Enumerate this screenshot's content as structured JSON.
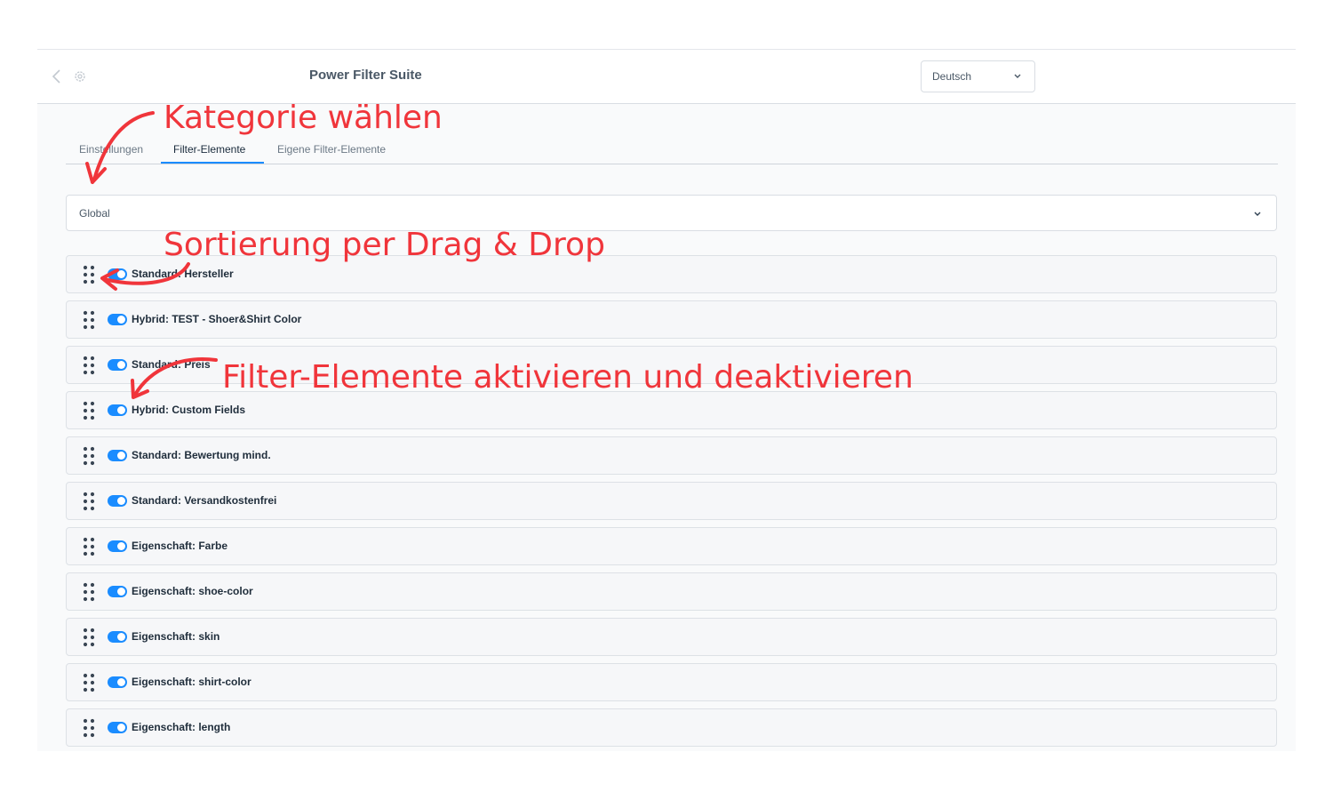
{
  "header": {
    "title": "Power Filter Suite",
    "language_select": {
      "value": "Deutsch"
    }
  },
  "tabs": [
    {
      "label": "Einstellungen",
      "active": false
    },
    {
      "label": "Filter-Elemente",
      "active": true
    },
    {
      "label": "Eigene Filter-Elemente",
      "active": false
    }
  ],
  "category_select": {
    "value": "Global"
  },
  "filter_items": [
    {
      "label": "Standard: Hersteller",
      "enabled": true
    },
    {
      "label": "Hybrid: TEST - Shoer&Shirt Color",
      "enabled": true
    },
    {
      "label": "Standard: Preis",
      "enabled": true
    },
    {
      "label": "Hybrid: Custom Fields",
      "enabled": true
    },
    {
      "label": "Standard: Bewertung mind.",
      "enabled": true
    },
    {
      "label": "Standard: Versandkostenfrei",
      "enabled": true
    },
    {
      "label": "Eigenschaft: Farbe",
      "enabled": true
    },
    {
      "label": "Eigenschaft: shoe-color",
      "enabled": true
    },
    {
      "label": "Eigenschaft: skin",
      "enabled": true
    },
    {
      "label": "Eigenschaft: shirt-color",
      "enabled": true
    },
    {
      "label": "Eigenschaft: length",
      "enabled": true
    }
  ],
  "annotations": {
    "category": "Kategorie wählen",
    "sorting": "Sortierung per Drag & Drop",
    "toggle": "Filter-Elemente aktivieren und deaktivieren"
  },
  "colors": {
    "accent": "#1a8cff",
    "annotation": "#f0353b"
  }
}
